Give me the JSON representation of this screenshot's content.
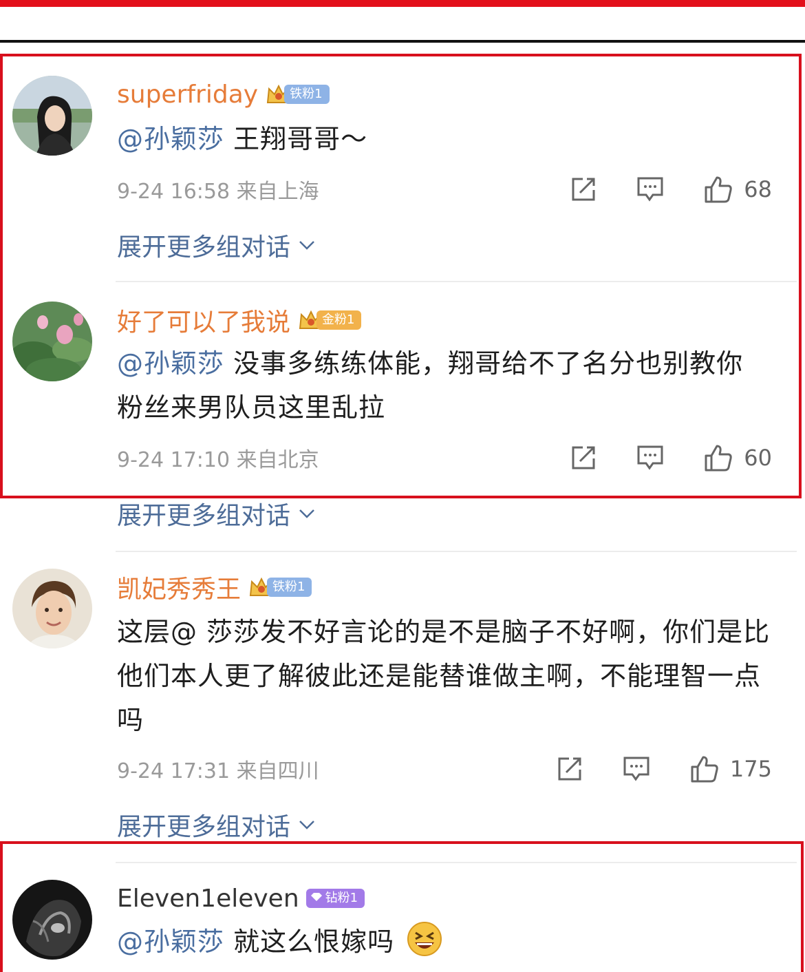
{
  "comments": [
    {
      "username": "superfriday",
      "badge": {
        "label": "铁粉1",
        "type": "iron"
      },
      "mention": "@孙颖莎",
      "body": " 王翔哥哥～",
      "meta": "9-24 16:58  来自上海",
      "likes": "68",
      "expand": "展开更多组对话"
    },
    {
      "username": "好了可以了我说",
      "badge": {
        "label": "金粉1",
        "type": "gold"
      },
      "mention": "@孙颖莎",
      "body": " 没事多练练体能，翔哥给不了名分也别教你粉丝来男队员这里乱拉",
      "meta": "9-24 17:10  来自北京",
      "likes": "60",
      "expand": "展开更多组对话"
    },
    {
      "username": "凯妃秀秀王",
      "badge": {
        "label": "铁粉1",
        "type": "iron"
      },
      "mention": "",
      "body": "这层@ 莎莎发不好言论的是不是脑子不好啊，你们是比他们本人更了解彼此还是能替谁做主啊，不能理智一点吗",
      "meta": "9-24 17:31  来自四川",
      "likes": "175",
      "expand": "展开更多组对话"
    },
    {
      "username": "Eleven1eleven",
      "badge": {
        "label": "钻粉1",
        "type": "diamond"
      },
      "mention": "@孙颖莎",
      "body": " 就这么恨嫁吗",
      "emoji": "grinning-squint-emoji"
    }
  ],
  "colors": {
    "highlight_border": "#d8101d",
    "username": "#e67c39",
    "mention": "#4a6ea0",
    "meta": "#9a9a9a"
  },
  "icons": [
    "share-icon",
    "reply-icon",
    "like-icon",
    "chevron-down-icon",
    "crown-icon"
  ]
}
